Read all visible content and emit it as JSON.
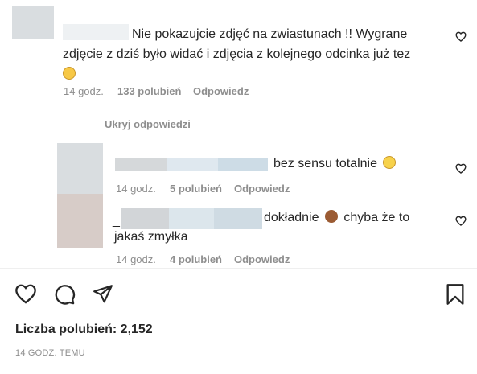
{
  "comment_main": {
    "text_line1": "Nie pokazujcie zdjęć na zwiastunach !! Wygrane",
    "text_line2": "zdjęcie z dziś było widać i zdjęcia z kolejnego odcinka już tez",
    "emoji_icon": "smirking-face-icon",
    "time": "14 godz.",
    "likes": "133 polubień",
    "reply": "Odpowiedz"
  },
  "replies_toggle": {
    "label": "Ukryj odpowiedzi"
  },
  "reply1": {
    "text": "bez sensu totalnie",
    "emoji_icon": "face-with-rolling-eyes-icon",
    "time": "14 godz.",
    "likes": "5 polubień",
    "reply": "Odpowiedz"
  },
  "reply2": {
    "prefix": "_",
    "text_line1": "dokładnie",
    "emoji_icon": "see-no-evil-monkey-icon",
    "text_after_emoji": "chyba że to",
    "text_line2": "jakaś zmyłka",
    "time": "14 godz.",
    "likes": "4 polubień",
    "reply": "Odpowiedz"
  },
  "post_footer": {
    "likes_label": "Liczba polubień: 2,152",
    "timestamp": "14 GODZ. TEMU"
  },
  "colors": {
    "text": "#262626",
    "meta": "#8e8e8e",
    "divider": "#efefef"
  }
}
